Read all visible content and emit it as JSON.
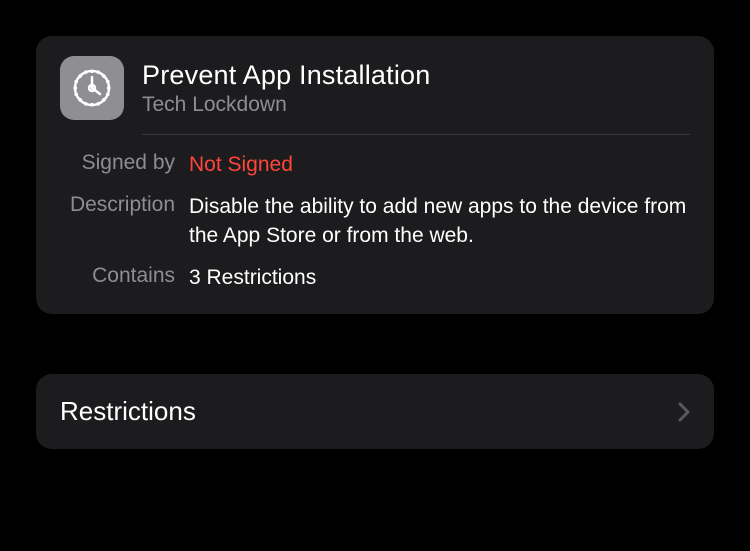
{
  "profile": {
    "title": "Prevent App Installation",
    "subtitle": "Tech Lockdown",
    "rows": {
      "signed_by": {
        "label": "Signed by",
        "value": "Not Signed"
      },
      "description": {
        "label": "Description",
        "value": "Disable the ability to add new apps to the device from the App Store or from the web."
      },
      "contains": {
        "label": "Contains",
        "value": "3 Restrictions"
      }
    }
  },
  "nav": {
    "restrictions_label": "Restrictions"
  }
}
